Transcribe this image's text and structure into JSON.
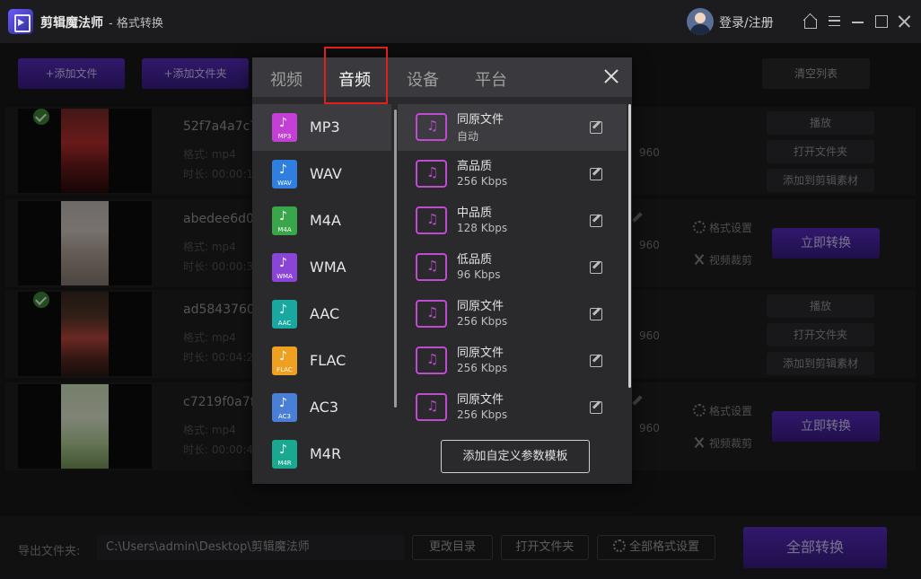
{
  "titlebar": {
    "app_name": "剪辑魔法师",
    "subtitle": "- 格式转换",
    "login": "登录/注册"
  },
  "toolbar": {
    "add_file": "+添加文件",
    "add_folder": "+添加文件夹",
    "clear_list": "清空列表"
  },
  "rows": [
    {
      "name": "52f7a4a7c7",
      "format": "格式: mp4",
      "duration": "时长: 00:00:1",
      "res": "960",
      "done": true,
      "play": "播放",
      "open_folder": "打开文件夹",
      "add_material": "添加到剪辑素材"
    },
    {
      "name": "abedee6d0c",
      "format": "格式: mp4",
      "duration": "时长: 00:00:36",
      "res": "960",
      "done": false,
      "format_settings": "格式设置",
      "video_crop": "视频裁剪",
      "convert": "立即转换"
    },
    {
      "name": "ad5843760f",
      "format": "格式: mp4",
      "duration": "时长: 00:04:26",
      "res": "960",
      "done": true,
      "play": "播放",
      "open_folder": "打开文件夹",
      "add_material": "添加到剪辑素材"
    },
    {
      "name": "c7219f0a7f1",
      "format": "格式: mp4",
      "duration": "时长: 00:00:46",
      "res": "960",
      "done": false,
      "format_settings": "格式设置",
      "video_crop": "视频裁剪",
      "convert": "立即转换"
    }
  ],
  "bottom": {
    "export_label": "导出文件夹:",
    "export_path": "C:\\Users\\admin\\Desktop\\剪辑魔法师",
    "change_dir": "更改目录",
    "open_folder": "打开文件夹",
    "all_format_settings": "全部格式设置",
    "convert_all": "全部转换"
  },
  "popup": {
    "tabs": [
      "视频",
      "音频",
      "设备",
      "平台"
    ],
    "active_tab": "音频",
    "formats": [
      {
        "label": "MP3",
        "tag": "MP3",
        "color": "#c33fd6"
      },
      {
        "label": "WAV",
        "tag": "WAV",
        "color": "#2f7fe0"
      },
      {
        "label": "M4A",
        "tag": "M4A",
        "color": "#3aa64a"
      },
      {
        "label": "WMA",
        "tag": "WMA",
        "color": "#8a45d8"
      },
      {
        "label": "AAC",
        "tag": "AAC",
        "color": "#19a8a0"
      },
      {
        "label": "FLAC",
        "tag": "FLAC",
        "color": "#f0a020"
      },
      {
        "label": "AC3",
        "tag": "AC3",
        "color": "#4a7fd8"
      },
      {
        "label": "M4R",
        "tag": "M4R",
        "color": "#19a890"
      }
    ],
    "qualities": [
      {
        "name": "同原文件",
        "rate": "自动"
      },
      {
        "name": "高品质",
        "rate": "256 Kbps"
      },
      {
        "name": "中品质",
        "rate": "128 Kbps"
      },
      {
        "name": "低品质",
        "rate": "96 Kbps"
      },
      {
        "name": "同原文件",
        "rate": "256 Kbps"
      },
      {
        "name": "同原文件",
        "rate": "256 Kbps"
      },
      {
        "name": "同原文件",
        "rate": "256 Kbps"
      }
    ],
    "custom_button": "添加自定义参数模板"
  }
}
